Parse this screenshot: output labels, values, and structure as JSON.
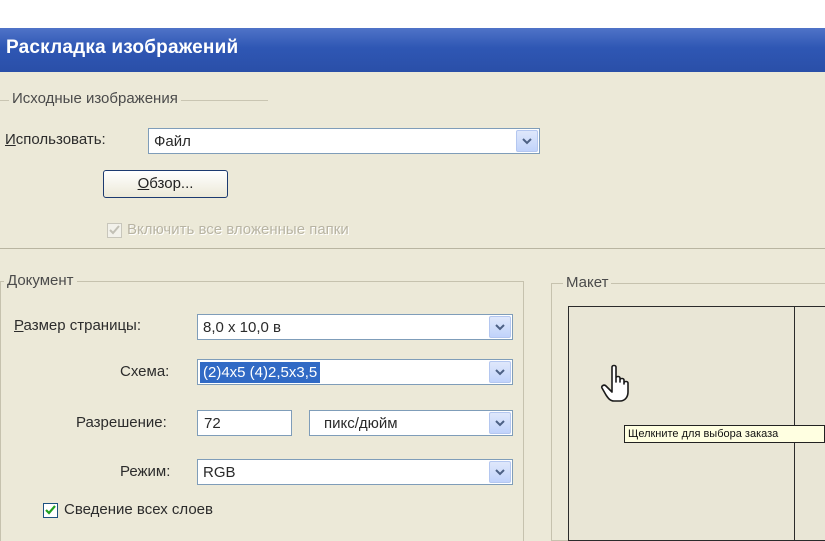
{
  "window": {
    "title": "Раскладка изображений"
  },
  "source": {
    "group_label": "Исходные изображения",
    "use_label_prefix": "И",
    "use_label_rest": "спользовать:",
    "use_value": "Файл",
    "browse_label_prefix": "О",
    "browse_label_rest": "бзор...",
    "include_subfolders_label": "Включить все вложенные папки",
    "include_subfolders_checked": true
  },
  "document": {
    "group_label": "Документ",
    "page_size_label_prefix": "Р",
    "page_size_label_rest": "азмер страницы:",
    "page_size_value": "8,0 x 10,0 в",
    "layout_label": "Схема:",
    "layout_value": "(2)4x5 (4)2,5x3,5",
    "resolution_label": "Разрешение:",
    "resolution_value": "72",
    "resolution_unit": "пикс/дюйм",
    "mode_label": "Режим:",
    "mode_value": "RGB",
    "flatten_label": "Сведение всех слоев",
    "flatten_checked": true
  },
  "layout": {
    "group_label": "Макет",
    "tooltip": "Щелкните для выбора заказа"
  },
  "icons": {
    "dropdown": "chevron-down-icon",
    "checkbox": "checkmark-icon",
    "cursor": "hand-pointer-icon"
  },
  "colors": {
    "titlebar": "#2f57b4",
    "selection": "#316ac5",
    "dialog_bg": "#ece9d8",
    "tooltip_bg": "#ffffe1"
  }
}
